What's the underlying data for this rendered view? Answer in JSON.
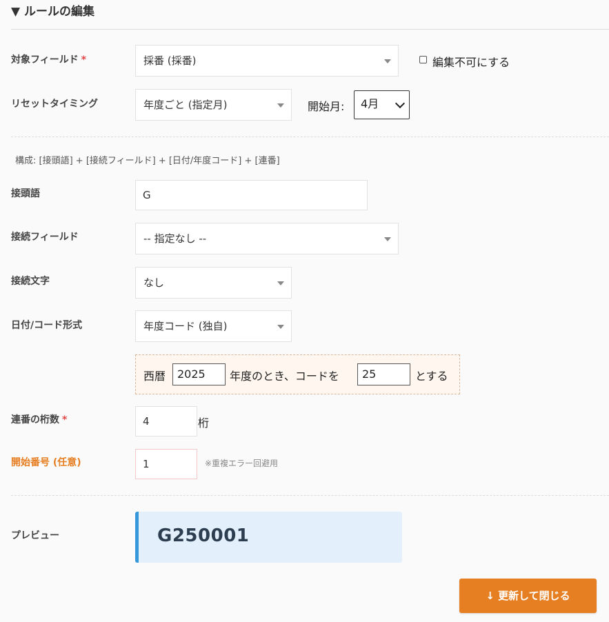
{
  "section": {
    "title": "▼ ルールの編集"
  },
  "target_field": {
    "label": "対象フィールド",
    "required_mark": "*",
    "value": "採番 (採番)",
    "readonly_label": "編集不可にする"
  },
  "reset_timing": {
    "label": "リセットタイミング",
    "value": "年度ごと (指定月)",
    "start_month_label": "開始月:",
    "start_month_value": "4月"
  },
  "structure_note": "構成: [接頭語] + [接続フィールド] + [日付/年度コード] + [連番]",
  "prefix": {
    "label": "接頭語",
    "value": "G"
  },
  "join_field": {
    "label": "接続フィールド",
    "value": "-- 指定なし --"
  },
  "join_char": {
    "label": "接続文字",
    "value": "なし"
  },
  "date_format": {
    "label": "日付/コード形式",
    "value": "年度コード (独自)"
  },
  "fiscal_code": {
    "prefix_text": "西暦",
    "year_value": "2025",
    "mid_text": "年度のとき、コードを",
    "code_value": "25",
    "suffix_text": "とする"
  },
  "digits": {
    "label": "連番の桁数",
    "required_mark": "*",
    "value": "4",
    "unit": "桁"
  },
  "start_number": {
    "label": "開始番号 (任意)",
    "value": "1",
    "note": "※重複エラー回避用"
  },
  "preview": {
    "label": "プレビュー",
    "value": "G250001"
  },
  "actions": {
    "update_close": "↓ 更新して閉じる"
  },
  "colors": {
    "accent": "#e67e22",
    "required": "#e14444",
    "preview_border": "#3498db",
    "preview_bg": "#e3f0fb"
  }
}
